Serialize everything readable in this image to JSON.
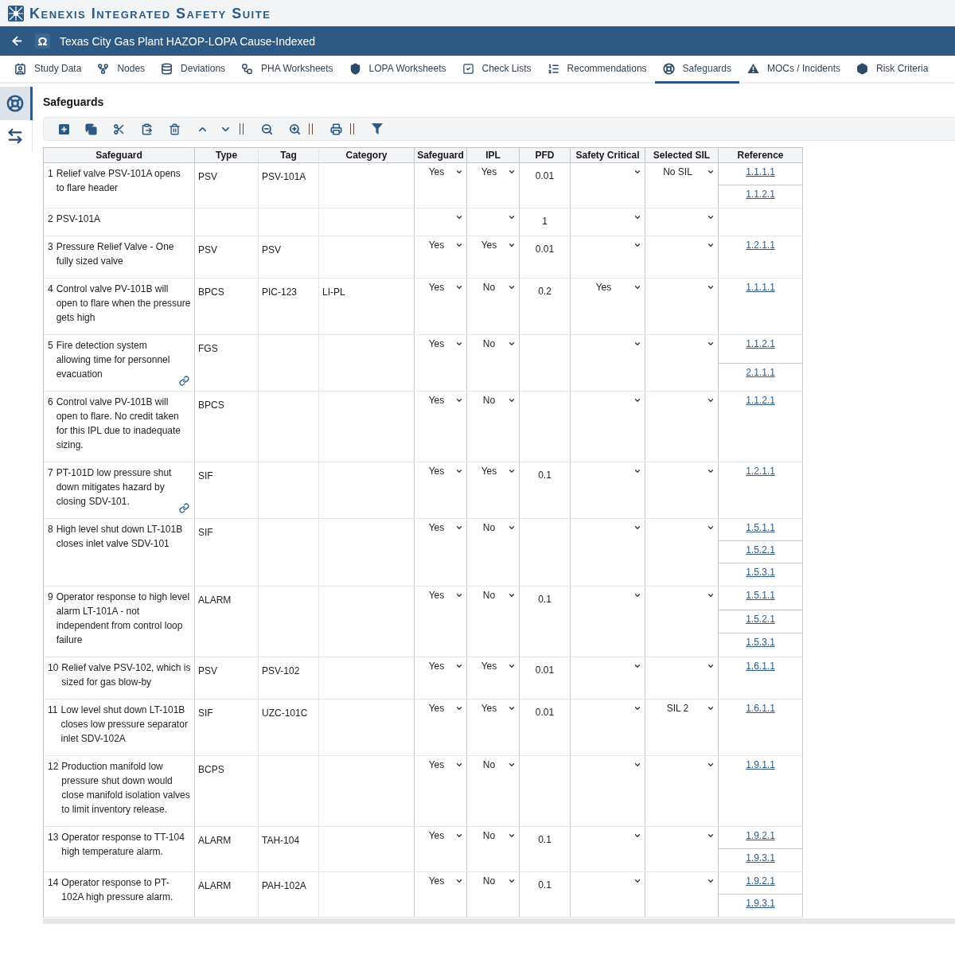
{
  "app": {
    "title": "Kenexis Integrated Safety Suite"
  },
  "study_bar": {
    "symbol": "Ω",
    "title": "Texas City Gas Plant HAZOP-LOPA Cause-Indexed"
  },
  "tabs": [
    {
      "label": "Study Data",
      "selected": false
    },
    {
      "label": "Nodes",
      "selected": false
    },
    {
      "label": "Deviations",
      "selected": false
    },
    {
      "label": "PHA Worksheets",
      "selected": false
    },
    {
      "label": "LOPA Worksheets",
      "selected": false
    },
    {
      "label": "Check Lists",
      "selected": false
    },
    {
      "label": "Recommendations",
      "selected": false
    },
    {
      "label": "Safeguards",
      "selected": true
    },
    {
      "label": "MOCs / Incidents",
      "selected": false
    },
    {
      "label": "Risk Criteria",
      "selected": false
    }
  ],
  "sidebar": {
    "items": [
      {
        "selected": true
      },
      {
        "selected": false
      }
    ]
  },
  "page": {
    "title": "Safeguards"
  },
  "table": {
    "columns": [
      "Safeguard",
      "Type",
      "Tag",
      "Category",
      "Safeguard",
      "IPL",
      "PFD",
      "Safety Critical",
      "Selected SIL",
      "Reference"
    ],
    "rows": [
      {
        "number": "1",
        "safeguard": "Relief valve PSV-101A opens to flare header",
        "type": "PSV",
        "tag": "PSV-101A",
        "is_safeguard": "Yes",
        "ipl": "Yes",
        "pfd": "0.01",
        "selected_sil": "No SIL",
        "references": [
          "1.1.1.1",
          "1.1.2.1"
        ],
        "linked": false
      },
      {
        "number": "2",
        "safeguard": "PSV-101A",
        "pfd": "1",
        "linked": false
      },
      {
        "number": "3",
        "safeguard": "Pressure Relief Valve - One fully sized valve",
        "type": "PSV",
        "tag": "PSV",
        "is_safeguard": "Yes",
        "ipl": "Yes",
        "pfd": "0.01",
        "references": [
          "1.2.1.1"
        ],
        "linked": false
      },
      {
        "number": "4",
        "safeguard": "Control valve PV-101B will open to flare when the pressure gets high",
        "type": "BPCS",
        "tag": "PIC-123",
        "category": "LI-PL",
        "is_safeguard": "Yes",
        "ipl": "No",
        "pfd": "0.2",
        "safety_critical": "Yes",
        "references": [
          "1.1.1.1"
        ],
        "linked": false
      },
      {
        "number": "5",
        "safeguard": "Fire detection system allowing time for personnel evacuation",
        "type": "FGS",
        "is_safeguard": "Yes",
        "ipl": "No",
        "references": [
          "1.1.2.1",
          "2.1.1.1"
        ],
        "linked": true
      },
      {
        "number": "6",
        "safeguard": "Control valve PV-101B will open to flare. No credit taken for this IPL due to inadequate sizing.",
        "type": "BPCS",
        "is_safeguard": "Yes",
        "ipl": "No",
        "references": [
          "1.1.2.1"
        ],
        "linked": false
      },
      {
        "number": "7",
        "safeguard": "PT-101D low pressure shut down mitigates hazard by closing SDV-101.",
        "type": "SIF",
        "is_safeguard": "Yes",
        "ipl": "Yes",
        "pfd": "0.1",
        "references": [
          "1.2.1.1"
        ],
        "linked": true
      },
      {
        "number": "8",
        "safeguard": "High level shut down LT-101B closes inlet valve SDV-101",
        "type": "SIF",
        "is_safeguard": "Yes",
        "ipl": "No",
        "references": [
          "1.5.1.1",
          "1.5.2.1",
          "1.5.3.1"
        ],
        "linked": false
      },
      {
        "number": "9",
        "safeguard": "Operator response to high level alarm LT-101A - not independent from control loop failure",
        "type": "ALARM",
        "is_safeguard": "Yes",
        "ipl": "No",
        "pfd": "0.1",
        "references": [
          "1.5.1.1",
          "1.5.2.1",
          "1.5.3.1"
        ],
        "linked": false
      },
      {
        "number": "10",
        "safeguard": "Relief valve PSV-102, which is sized for gas blow-by",
        "type": "PSV",
        "tag": "PSV-102",
        "is_safeguard": "Yes",
        "ipl": "Yes",
        "pfd": "0.01",
        "references": [
          "1.6.1.1"
        ],
        "linked": false
      },
      {
        "number": "11",
        "safeguard": "Low level shut down LT-101B closes low pressure separator inlet SDV-102A",
        "type": "SIF",
        "tag": "UZC-101C",
        "is_safeguard": "Yes",
        "ipl": "Yes",
        "pfd": "0.01",
        "selected_sil": "SIL 2",
        "references": [
          "1.6.1.1"
        ],
        "linked": false
      },
      {
        "number": "12",
        "safeguard": "Production manifold low pressure shut down would close manifold isolation valves to limit inventory release.",
        "type": "BCPS",
        "is_safeguard": "Yes",
        "ipl": "No",
        "references": [
          "1.9.1.1"
        ],
        "linked": false
      },
      {
        "number": "13",
        "safeguard": "Operator response to TT-104 high temperature alarm.",
        "type": "ALARM",
        "tag": "TAH-104",
        "is_safeguard": "Yes",
        "ipl": "No",
        "pfd": "0.1",
        "references": [
          "1.9.2.1",
          "1.9.3.1"
        ],
        "linked": false
      },
      {
        "number": "14",
        "safeguard": "Operator response to PT-102A high pressure alarm.",
        "type": "ALARM",
        "tag": "PAH-102A",
        "is_safeguard": "Yes",
        "ipl": "No",
        "pfd": "0.1",
        "references": [
          "1.9.2.1",
          "1.9.3.1"
        ],
        "linked": false
      }
    ]
  }
}
